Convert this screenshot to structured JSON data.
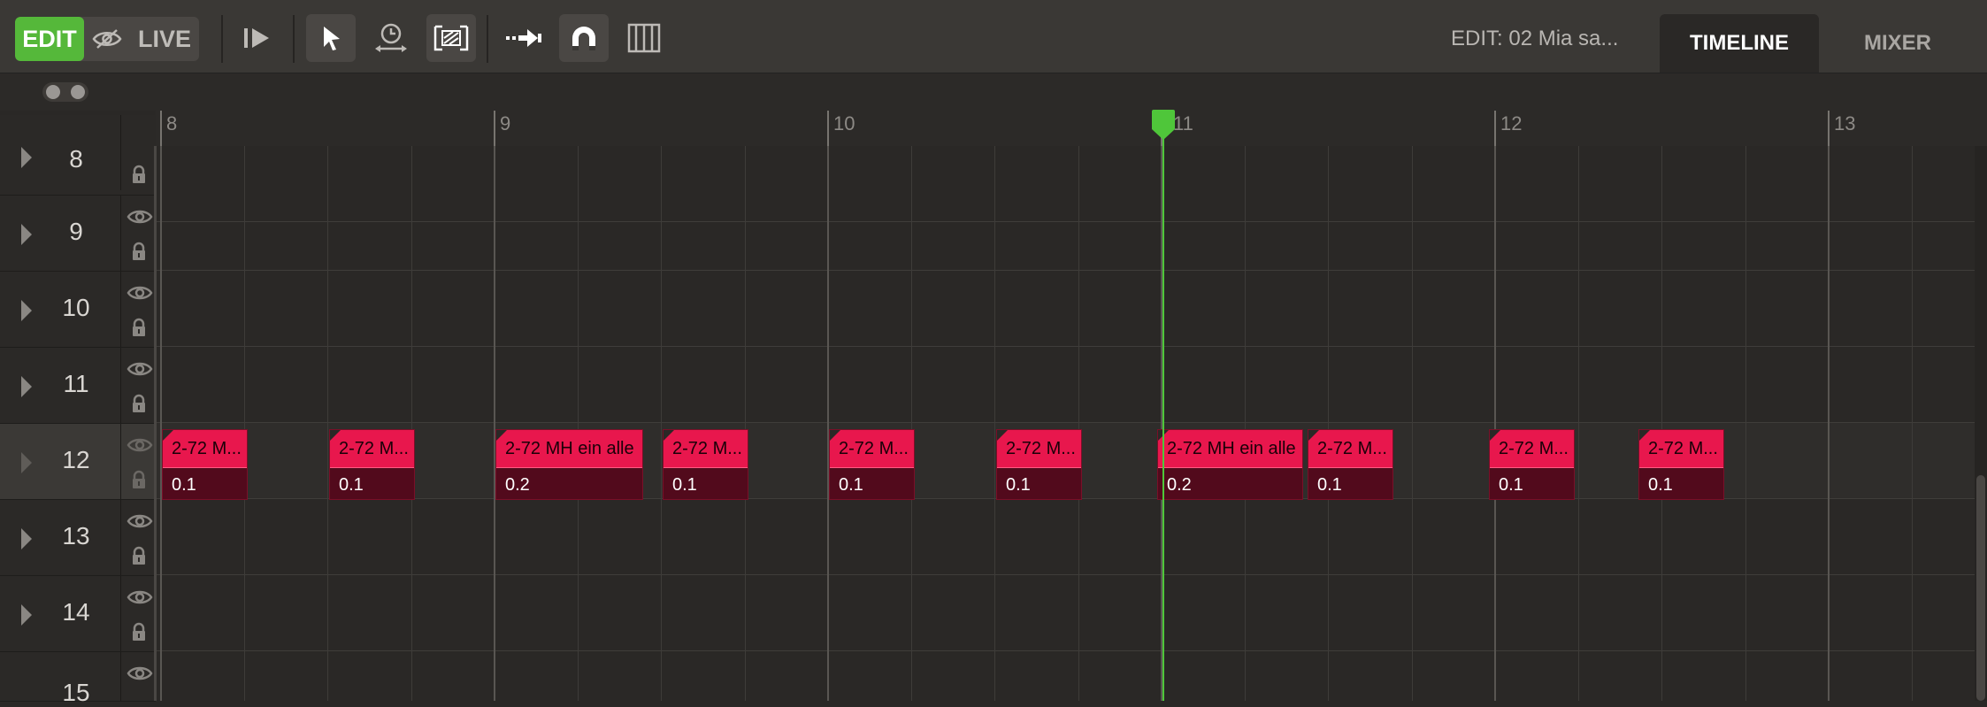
{
  "toolbar": {
    "mode_edit": "EDIT",
    "mode_live": "LIVE",
    "edit_title": "EDIT: 02 Mia sa...",
    "tabs": [
      {
        "label": "TIMELINE",
        "active": true
      },
      {
        "label": "MIXER",
        "active": false
      }
    ],
    "tools": [
      "play-from-icon",
      "select-arrow-icon",
      "time-stretch-icon",
      "crop-region-icon",
      "arrow-forward-icon",
      "magnet-snap-icon",
      "grid-columns-icon"
    ]
  },
  "ruler": {
    "labels": [
      "8",
      "9",
      "10",
      "11",
      "12",
      "13"
    ]
  },
  "tracks": [
    {
      "number": "8",
      "selected": false
    },
    {
      "number": "9",
      "selected": false
    },
    {
      "number": "10",
      "selected": false
    },
    {
      "number": "11",
      "selected": false
    },
    {
      "number": "12",
      "selected": true
    },
    {
      "number": "13",
      "selected": false
    },
    {
      "number": "14",
      "selected": false
    },
    {
      "number": "15",
      "selected": false
    }
  ],
  "clips": [
    {
      "title": "2-72 M...",
      "value": "0.1"
    },
    {
      "title": "2-72 M...",
      "value": "0.1"
    },
    {
      "title": "2-72 MH ein alle",
      "value": "0.2"
    },
    {
      "title": "2-72 M...",
      "value": "0.1"
    },
    {
      "title": "2-72 M...",
      "value": "0.1"
    },
    {
      "title": "2-72 M...",
      "value": "0.1"
    },
    {
      "title": "2-72 MH ein alle",
      "value": "0.2"
    },
    {
      "title": "2-72 M...",
      "value": "0.1"
    },
    {
      "title": "2-72 M...",
      "value": "0.1"
    },
    {
      "title": "2-72 M...",
      "value": "0.1"
    }
  ],
  "colors": {
    "accent_green": "#55b83a",
    "clip_red": "#e8174d",
    "clip_dark": "#520a1c",
    "playhead": "#4fc63a"
  }
}
